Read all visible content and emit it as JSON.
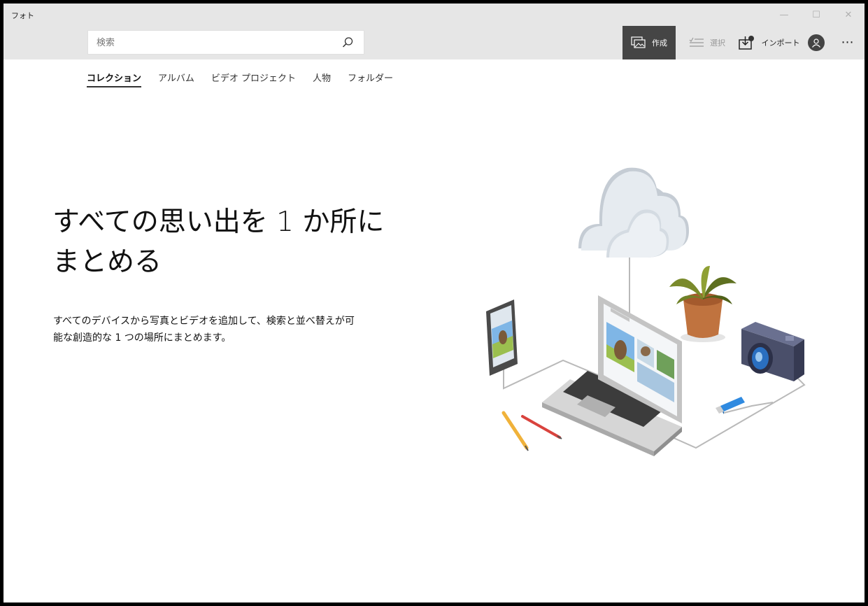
{
  "window": {
    "title": "フォト",
    "controls": {
      "minimize": "—",
      "maximize": "☐",
      "close": "✕"
    }
  },
  "search": {
    "placeholder": "検索",
    "value": ""
  },
  "toolbar": {
    "create_label": "作成",
    "select_label": "選択",
    "import_label": "インポート",
    "more_label": "⋯"
  },
  "tabs": [
    {
      "label": "コレクション",
      "active": true
    },
    {
      "label": "アルバム",
      "active": false
    },
    {
      "label": "ビデオ プロジェクト",
      "active": false
    },
    {
      "label": "人物",
      "active": false
    },
    {
      "label": "フォルダー",
      "active": false
    }
  ],
  "hero": {
    "title_line1": "すべての思い出を 1 か所に",
    "title_line2": "まとめる",
    "description_line1": "すべてのデバイスから写真とビデオを追加して、検索と並べ替えが可",
    "description_line2": "能な創造的な 1 つの場所にまとめます。"
  },
  "colors": {
    "titlebar_bg": "#e6e6e6",
    "create_button_bg": "#454545",
    "cloud": "#e2e8ee",
    "laptop": "#b8bbbf",
    "camera": "#4a4f6a",
    "lens": "#2a6fc0",
    "usb": "#2f8ae0"
  },
  "icons": [
    "search-icon",
    "create-icon",
    "select-icon",
    "import-icon",
    "account-icon",
    "more-icon"
  ]
}
